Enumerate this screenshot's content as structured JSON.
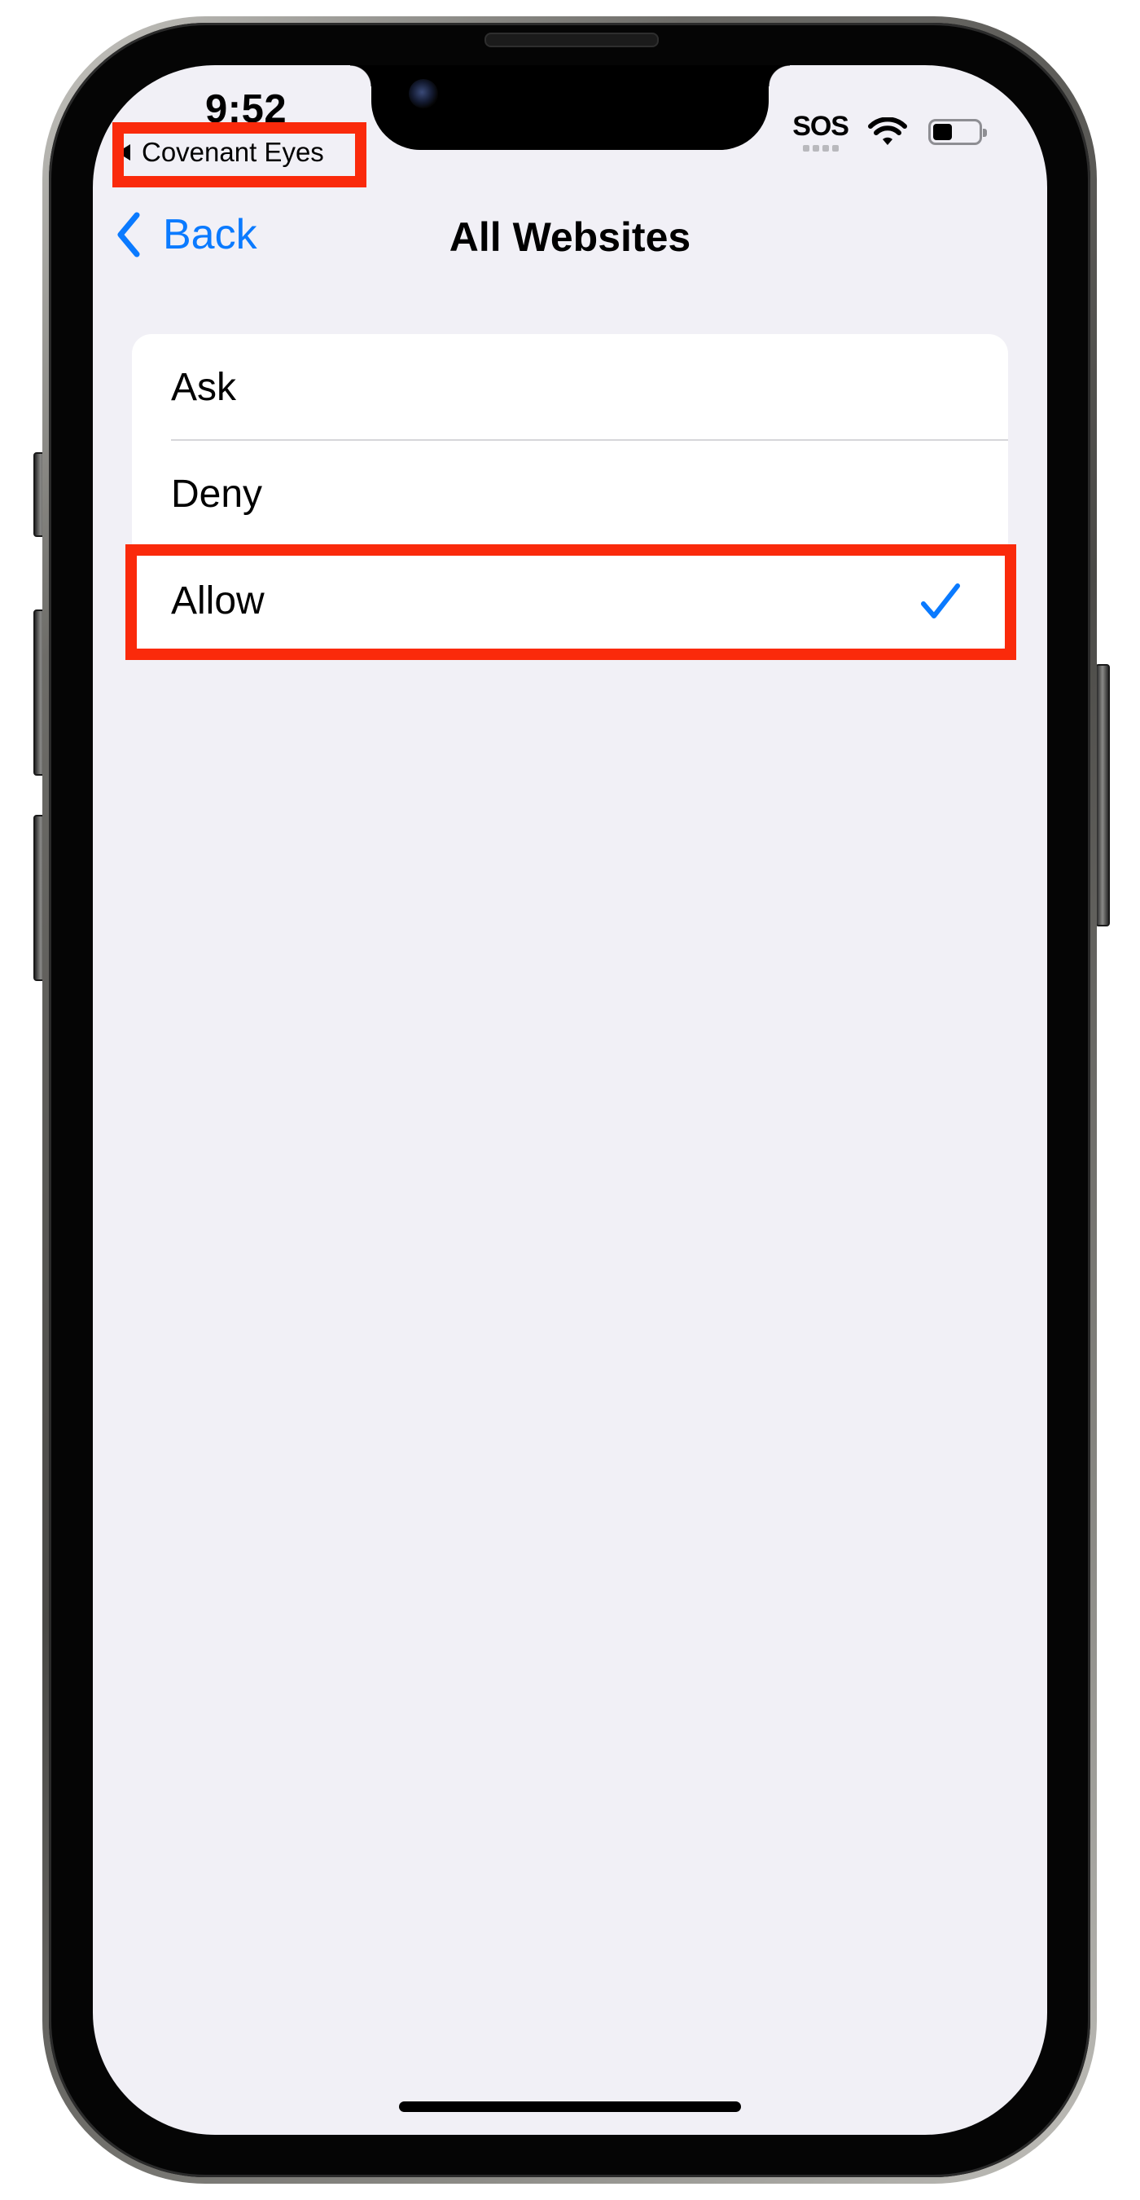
{
  "status_bar": {
    "time": "9:52",
    "back_app_label": "Covenant Eyes",
    "sos_label": "SOS",
    "battery_level": 0.42
  },
  "nav": {
    "back_label": "Back",
    "title": "All Websites"
  },
  "options": [
    {
      "label": "Ask",
      "selected": false
    },
    {
      "label": "Deny",
      "selected": false
    },
    {
      "label": "Allow",
      "selected": true
    }
  ],
  "colors": {
    "accent": "#0a7aff",
    "highlight": "#fa2a0b",
    "background": "#f1f0f6"
  },
  "icons": {
    "back": "chevron-left-icon",
    "selected": "checkmark-icon",
    "wifi": "wifi-icon",
    "battery": "battery-icon"
  }
}
